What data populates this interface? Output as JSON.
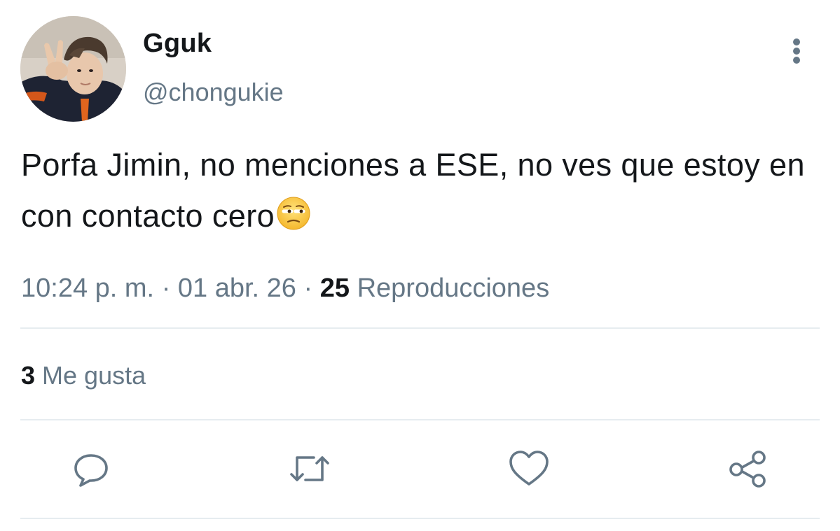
{
  "user": {
    "display_name": "Gguk",
    "handle": "@chongukie"
  },
  "tweet": {
    "text": "Porfa Jimin, no menciones a ESE, no ves que estoy en con contacto cero",
    "emoji_icon": "unamused-face-icon"
  },
  "meta": {
    "time": "10:24 p. m.",
    "separator": "·",
    "date": "01 abr. 26",
    "views_count": "25",
    "views_label": "Reproducciones"
  },
  "stats": {
    "likes_count": "3",
    "likes_label": "Me gusta"
  },
  "actions": [
    "reply-icon",
    "retweet-icon",
    "like-icon",
    "share-icon"
  ],
  "colors": {
    "text": "#14171a",
    "secondary": "#657786",
    "divider": "#e6ecf0",
    "icon": "#657786",
    "background": "#ffffff"
  }
}
